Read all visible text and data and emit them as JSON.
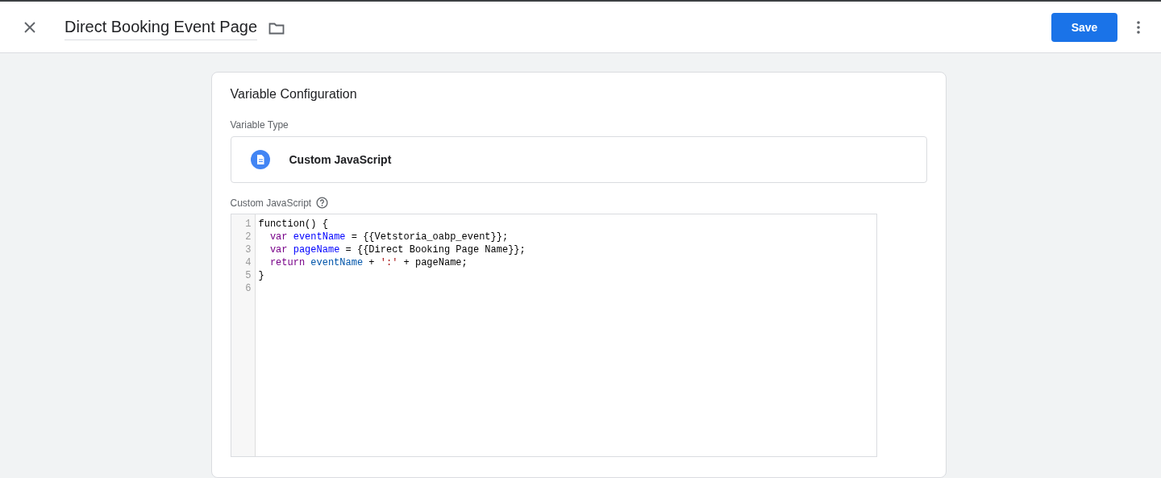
{
  "header": {
    "title": "Direct Booking Event Page",
    "save_button": "Save"
  },
  "card": {
    "title": "Variable Configuration",
    "type_label": "Variable Type",
    "type_name": "Custom JavaScript",
    "code_label": "Custom JavaScript",
    "code_lines": [
      {
        "number": "1",
        "tokens": [
          {
            "text": "function() {",
            "kind": "plain"
          }
        ]
      },
      {
        "number": "2",
        "tokens": [
          {
            "text": "  var ",
            "kind": "keyword"
          },
          {
            "text": "eventName",
            "kind": "variable"
          },
          {
            "text": " = {{Vetstoria_oabp_event}};",
            "kind": "plain"
          }
        ]
      },
      {
        "number": "3",
        "tokens": [
          {
            "text": "  var ",
            "kind": "keyword"
          },
          {
            "text": "pageName",
            "kind": "variable"
          },
          {
            "text": " = {{Direct Booking Page Name}};",
            "kind": "plain"
          }
        ]
      },
      {
        "number": "4",
        "tokens": [
          {
            "text": "  return ",
            "kind": "keyword"
          },
          {
            "text": "eventName",
            "kind": "name"
          },
          {
            "text": " + ",
            "kind": "plain"
          },
          {
            "text": "':'",
            "kind": "string"
          },
          {
            "text": " + pageName;",
            "kind": "plain"
          }
        ]
      },
      {
        "number": "5",
        "tokens": [
          {
            "text": "}",
            "kind": "plain"
          }
        ]
      },
      {
        "number": "6"
      }
    ]
  }
}
